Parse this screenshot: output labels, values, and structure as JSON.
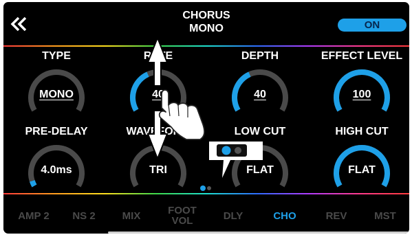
{
  "header": {
    "title_line1": "CHORUS",
    "title_line2": "MONO",
    "on_button": "ON",
    "back_icon": "double-chevron-left-icon"
  },
  "params": [
    {
      "label": "TYPE",
      "value": "MONO",
      "level": 0.0
    },
    {
      "label": "RATE",
      "value": "40",
      "level": 0.4
    },
    {
      "label": "DEPTH",
      "value": "40",
      "level": 0.4
    },
    {
      "label": "EFFECT LEVEL",
      "value": "100",
      "level": 1.0
    },
    {
      "label": "PRE-DELAY",
      "value": "4.0ms",
      "level": 0.05
    },
    {
      "label": "WAVEFORM",
      "value": "TRI",
      "level": 0.0
    },
    {
      "label": "LOW CUT",
      "value": "FLAT",
      "level": 0.0
    },
    {
      "label": "HIGH CUT",
      "value": "FLAT",
      "level": 1.0
    }
  ],
  "page_indicator": {
    "current": 1,
    "total": 2
  },
  "popup": {
    "icon": "page-toggle-icon"
  },
  "tabs": [
    "AMP 2",
    "NS 2",
    "MIX",
    "FOOT VOL",
    "DLY",
    "CHO",
    "REV",
    "MST"
  ],
  "active_tab": "CHO",
  "gesture": {
    "icon": "swipe-up-down-hand-icon"
  },
  "colors": {
    "accent": "#1ea0e8",
    "arc_bg": "#4a4a4a",
    "background": "#000000"
  }
}
